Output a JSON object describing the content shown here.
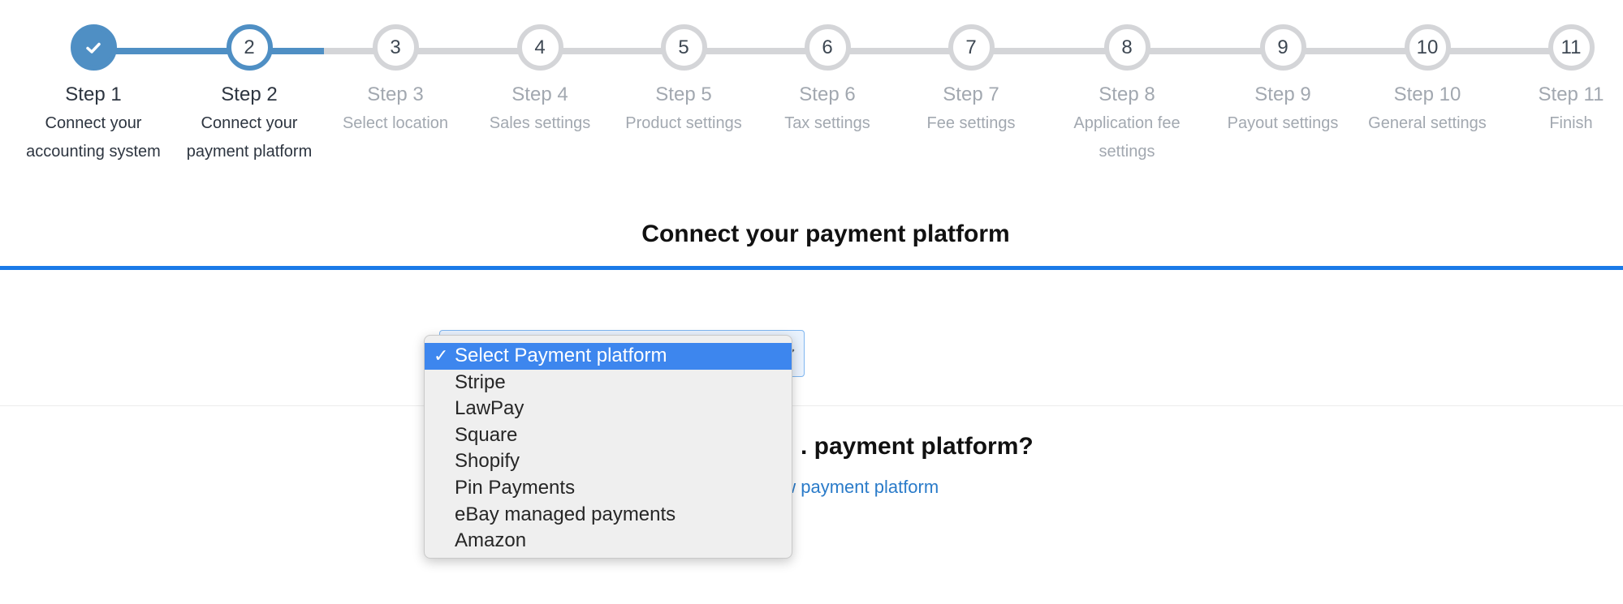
{
  "colors": {
    "accent": "#4f8fc4",
    "rule": "#1a7ae8",
    "link": "#2a7bc9",
    "menu_highlight": "#3d86ee"
  },
  "steps": [
    {
      "number": "",
      "title": "Step 1",
      "description": "Connect your accounting system",
      "status": "completed",
      "icon": "check-icon"
    },
    {
      "number": "2",
      "title": "Step 2",
      "description": "Connect your payment platform",
      "status": "current"
    },
    {
      "number": "3",
      "title": "Step 3",
      "description": "Select location",
      "status": "upcoming"
    },
    {
      "number": "4",
      "title": "Step 4",
      "description": "Sales settings",
      "status": "upcoming"
    },
    {
      "number": "5",
      "title": "Step 5",
      "description": "Product settings",
      "status": "upcoming"
    },
    {
      "number": "6",
      "title": "Step 6",
      "description": "Tax settings",
      "status": "upcoming"
    },
    {
      "number": "7",
      "title": "Step 7",
      "description": "Fee settings",
      "status": "upcoming"
    },
    {
      "number": "8",
      "title": "Step 8",
      "description": "Application fee settings",
      "status": "upcoming"
    },
    {
      "number": "9",
      "title": "Step 9",
      "description": "Payout settings",
      "status": "upcoming"
    },
    {
      "number": "10",
      "title": "Step 10",
      "description": "General settings",
      "status": "upcoming"
    },
    {
      "number": "11",
      "title": "Step 11",
      "description": "Finish",
      "status": "upcoming"
    }
  ],
  "page": {
    "title": "Connect your payment platform"
  },
  "select": {
    "selected_value": "Select Payment platform",
    "check_mark": "✓",
    "options": [
      "Select Payment platform",
      "Stripe",
      "LawPay",
      "Square",
      "Shopify",
      "Pin Payments",
      "eBay managed payments",
      "Amazon"
    ]
  },
  "help": {
    "title_visible": ". payment platform?",
    "link_visible": "ew payment platform"
  }
}
